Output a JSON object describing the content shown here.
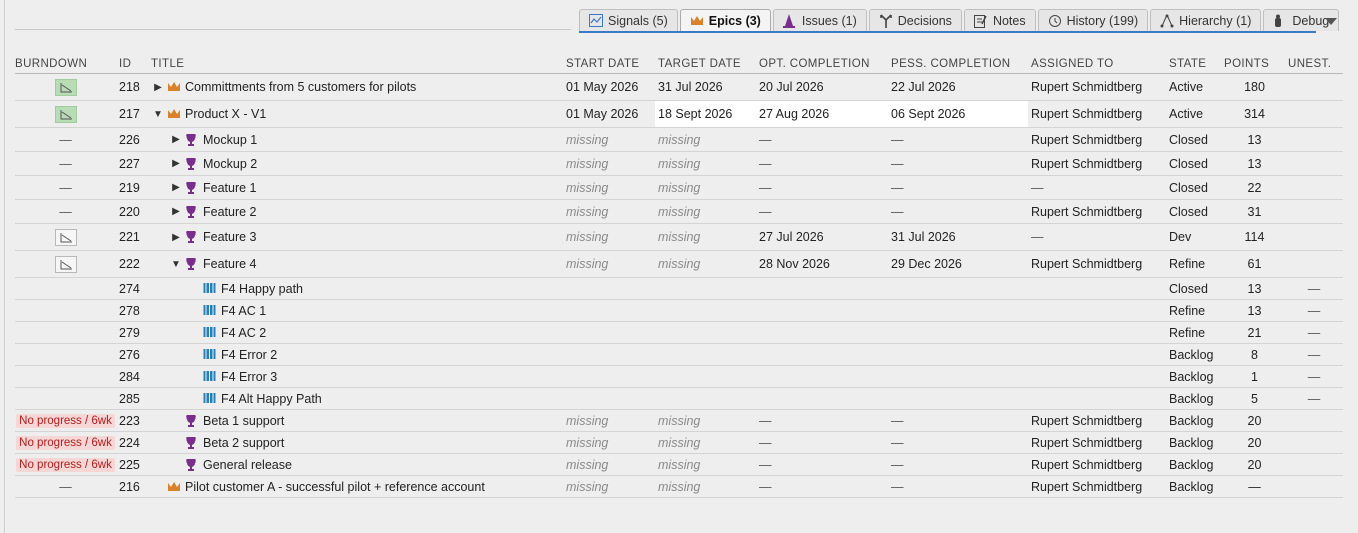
{
  "tabs": [
    {
      "label": "Signals (5)",
      "icon": "signals-icon",
      "active": false
    },
    {
      "label": "Epics (3)",
      "icon": "crown-icon",
      "active": true
    },
    {
      "label": "Issues (1)",
      "icon": "cone-icon",
      "active": false
    },
    {
      "label": "Decisions",
      "icon": "decisions-icon",
      "active": false
    },
    {
      "label": "Notes",
      "icon": "notes-icon",
      "active": false
    },
    {
      "label": "History (199)",
      "icon": "history-icon",
      "active": false
    },
    {
      "label": "Hierarchy (1)",
      "icon": "hierarchy-icon",
      "active": false
    },
    {
      "label": "Debug",
      "icon": "debug-icon",
      "active": false
    }
  ],
  "colors": {
    "accent": "#3a78c8",
    "crown": "#d9822b",
    "trophy": "#7b2d8e",
    "story": "#2a7fb8",
    "noprogress_bg": "#f7d6d6",
    "noprogress_fg": "#b21d1d",
    "burndown_green": "#b8dcb5"
  },
  "table": {
    "headers": {
      "burndown": "BURNDOWN",
      "id": "ID",
      "title": "TITLE",
      "start": "START DATE",
      "target": "TARGET DATE",
      "opt": "OPT. COMPLETION",
      "pess": "PESS. COMPLETION",
      "assigned": "ASSIGNED TO",
      "state": "STATE",
      "points": "POINTS",
      "unest": "UNEST."
    },
    "rows": [
      {
        "burndown": "chart-green",
        "id": "218",
        "toggle": "▶",
        "indent": 0,
        "type": "crown",
        "title": "Committments from 5 customers for pilots",
        "start": "01 May 2026",
        "target": "31 Jul 2026",
        "opt": "20 Jul 2026",
        "pess": "22 Jul 2026",
        "assigned": "Rupert Schmidtberg",
        "state": "Active",
        "points": "180",
        "unest": "",
        "size": "tall"
      },
      {
        "burndown": "chart-green",
        "id": "217",
        "toggle": "▼",
        "indent": 0,
        "type": "crown",
        "title": "Product X - V1",
        "start": "01 May 2026",
        "target": "18 Sept 2026",
        "opt": "27 Aug 2026",
        "pess": "06 Sept 2026",
        "assigned": "Rupert Schmidtberg",
        "state": "Active",
        "points": "314",
        "unest": "",
        "size": "tall",
        "highlight": true
      },
      {
        "burndown": "—",
        "id": "226",
        "toggle": "▶",
        "indent": 1,
        "type": "trophy",
        "title": "Mockup 1",
        "start": "missing",
        "target": "missing",
        "opt": "—",
        "pess": "—",
        "assigned": "Rupert Schmidtberg",
        "state": "Closed",
        "points": "13",
        "unest": "",
        "size": "mid"
      },
      {
        "burndown": "—",
        "id": "227",
        "toggle": "▶",
        "indent": 1,
        "type": "trophy",
        "title": "Mockup 2",
        "start": "missing",
        "target": "missing",
        "opt": "—",
        "pess": "—",
        "assigned": "Rupert Schmidtberg",
        "state": "Closed",
        "points": "13",
        "unest": "",
        "size": "mid"
      },
      {
        "burndown": "—",
        "id": "219",
        "toggle": "▶",
        "indent": 1,
        "type": "trophy",
        "title": "Feature 1",
        "start": "missing",
        "target": "missing",
        "opt": "—",
        "pess": "—",
        "assigned": "—",
        "state": "Closed",
        "points": "22",
        "unest": "",
        "size": "mid"
      },
      {
        "burndown": "—",
        "id": "220",
        "toggle": "▶",
        "indent": 1,
        "type": "trophy",
        "title": "Feature 2",
        "start": "missing",
        "target": "missing",
        "opt": "—",
        "pess": "—",
        "assigned": "Rupert Schmidtberg",
        "state": "Closed",
        "points": "31",
        "unest": "",
        "size": "mid"
      },
      {
        "burndown": "chart",
        "id": "221",
        "toggle": "▶",
        "indent": 1,
        "type": "trophy",
        "title": "Feature 3",
        "start": "missing",
        "target": "missing",
        "opt": "27 Jul 2026",
        "pess": "31 Jul 2026",
        "assigned": "—",
        "state": "Dev",
        "points": "114",
        "unest": "",
        "size": "tall"
      },
      {
        "burndown": "chart",
        "id": "222",
        "toggle": "▼",
        "indent": 1,
        "type": "trophy",
        "title": "Feature 4",
        "start": "missing",
        "target": "missing",
        "opt": "28 Nov 2026",
        "pess": "29 Dec 2026",
        "assigned": "Rupert Schmidtberg",
        "state": "Refine",
        "points": "61",
        "unest": "",
        "size": "tall"
      },
      {
        "burndown": "",
        "id": "274",
        "toggle": "",
        "indent": 2,
        "type": "story",
        "title": "F4 Happy path",
        "start": "",
        "target": "",
        "opt": "",
        "pess": "",
        "assigned": "",
        "state": "Closed",
        "points": "13",
        "unest": "—",
        "size": "short"
      },
      {
        "burndown": "",
        "id": "278",
        "toggle": "",
        "indent": 2,
        "type": "story",
        "title": "F4 AC 1",
        "start": "",
        "target": "",
        "opt": "",
        "pess": "",
        "assigned": "",
        "state": "Refine",
        "points": "13",
        "unest": "—",
        "size": "short"
      },
      {
        "burndown": "",
        "id": "279",
        "toggle": "",
        "indent": 2,
        "type": "story",
        "title": "F4 AC 2",
        "start": "",
        "target": "",
        "opt": "",
        "pess": "",
        "assigned": "",
        "state": "Refine",
        "points": "21",
        "unest": "—",
        "size": "short"
      },
      {
        "burndown": "",
        "id": "276",
        "toggle": "",
        "indent": 2,
        "type": "story",
        "title": "F4 Error 2",
        "start": "",
        "target": "",
        "opt": "",
        "pess": "",
        "assigned": "",
        "state": "Backlog",
        "points": "8",
        "unest": "—",
        "size": "short"
      },
      {
        "burndown": "",
        "id": "284",
        "toggle": "",
        "indent": 2,
        "type": "story",
        "title": "F4 Error 3",
        "start": "",
        "target": "",
        "opt": "",
        "pess": "",
        "assigned": "",
        "state": "Backlog",
        "points": "1",
        "unest": "—",
        "size": "short"
      },
      {
        "burndown": "",
        "id": "285",
        "toggle": "",
        "indent": 2,
        "type": "story",
        "title": "F4 Alt Happy Path",
        "start": "",
        "target": "",
        "opt": "",
        "pess": "",
        "assigned": "",
        "state": "Backlog",
        "points": "5",
        "unest": "—",
        "size": "short"
      },
      {
        "burndown": "No progress / 6wk",
        "id": "223",
        "toggle": "",
        "indent": 1,
        "type": "trophy",
        "title": "Beta 1 support",
        "start": "missing",
        "target": "missing",
        "opt": "—",
        "pess": "—",
        "assigned": "Rupert Schmidtberg",
        "state": "Backlog",
        "points": "20",
        "unest": "",
        "size": "short"
      },
      {
        "burndown": "No progress / 6wk",
        "id": "224",
        "toggle": "",
        "indent": 1,
        "type": "trophy",
        "title": "Beta 2 support",
        "start": "missing",
        "target": "missing",
        "opt": "—",
        "pess": "—",
        "assigned": "Rupert Schmidtberg",
        "state": "Backlog",
        "points": "20",
        "unest": "",
        "size": "short"
      },
      {
        "burndown": "No progress / 6wk",
        "id": "225",
        "toggle": "",
        "indent": 1,
        "type": "trophy",
        "title": "General release",
        "start": "missing",
        "target": "missing",
        "opt": "—",
        "pess": "—",
        "assigned": "Rupert Schmidtberg",
        "state": "Backlog",
        "points": "20",
        "unest": "",
        "size": "short"
      },
      {
        "burndown": "—",
        "id": "216",
        "toggle": "",
        "indent": 0,
        "type": "crown",
        "title": "Pilot customer A - successful pilot + reference account",
        "start": "missing",
        "target": "missing",
        "opt": "—",
        "pess": "—",
        "assigned": "Rupert Schmidtberg",
        "state": "Backlog",
        "points": "—",
        "unest": "",
        "size": "short"
      }
    ]
  }
}
